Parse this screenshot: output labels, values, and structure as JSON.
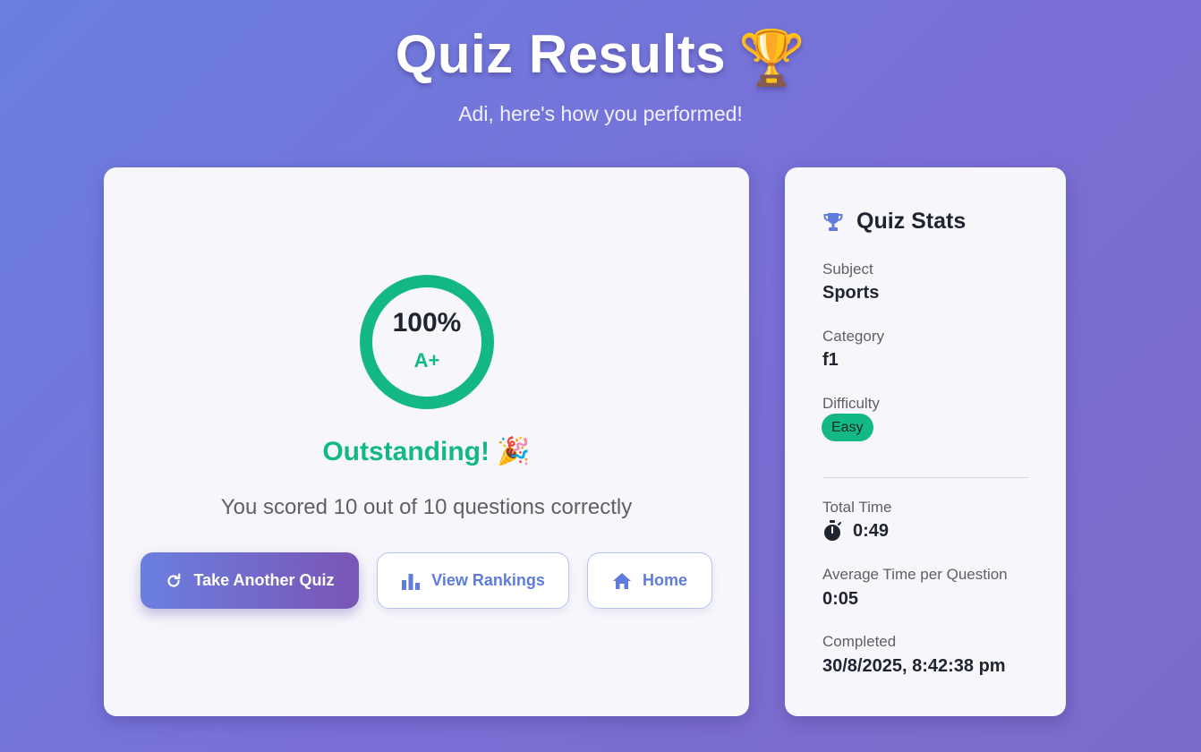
{
  "header": {
    "title": "Quiz Results",
    "trophy_emoji": "🏆",
    "subtitle": "Adi, here's how you performed!"
  },
  "result": {
    "percent_text": "100%",
    "percent": 100,
    "grade": "A+",
    "praise": "Outstanding! 🎉",
    "score_line": "You scored 10 out of 10 questions correctly",
    "ring_color": "#14b885"
  },
  "actions": {
    "take_another": "Take Another Quiz",
    "view_rankings": "View Rankings",
    "home": "Home"
  },
  "stats": {
    "title": "Quiz Stats",
    "subject_label": "Subject",
    "subject": "Sports",
    "category_label": "Category",
    "category": "f1",
    "difficulty_label": "Difficulty",
    "difficulty": "Easy",
    "total_time_label": "Total Time",
    "total_time": "0:49",
    "avg_time_label": "Average Time per Question",
    "avg_time": "0:05",
    "completed_label": "Completed",
    "completed": "30/8/2025, 8:42:38 pm"
  },
  "icons": {
    "refresh": "refresh-icon",
    "rankings": "bar-chart-icon",
    "home": "home-icon",
    "trophy": "trophy-icon",
    "stopwatch": "stopwatch-icon"
  },
  "colors": {
    "accent": "#5f7bdc",
    "success": "#14b885"
  }
}
